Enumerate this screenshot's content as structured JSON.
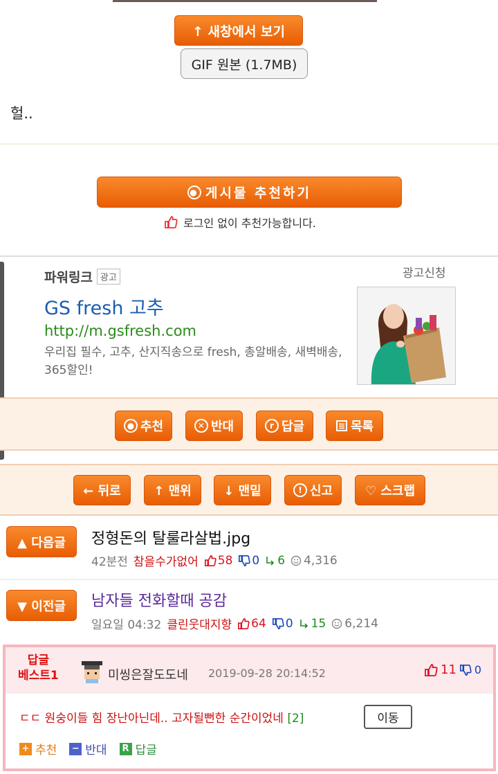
{
  "image_viewer": {
    "new_window_label": "↑ 새창에서 보기",
    "gif_original_label": "GIF 원본 (1.7MB)"
  },
  "post": {
    "body_text": "헐.."
  },
  "recommend": {
    "button_label": "게시물  추천하기",
    "login_note": "로그인 없이 추천가능합니다."
  },
  "ad": {
    "powerlink_label": "파워링크",
    "ad_tag": "광고",
    "apply_label": "광고신청",
    "headline": "GS fresh 고추",
    "url": "http://m.gsfresh.com",
    "description": "우리집 필수, 고추, 산지직송으로 fresh, 총알배송, 새벽배송, 365할인!"
  },
  "toolbar1": {
    "recommend": "추천",
    "oppose": "반대",
    "reply": "답글",
    "list": "목록"
  },
  "toolbar2": {
    "back": "← 뒤로",
    "top": "↑ 맨위",
    "bottom": "↓ 맨밑",
    "report": "신고",
    "scrap": "♡ 스크랩"
  },
  "next_post": {
    "button_label": "▲ 다음글",
    "title": "정형돈의 탈룰라살법.jpg",
    "time": "42분전",
    "author": "참을수가없어",
    "upvotes": "58",
    "downvotes": "0",
    "replies": "6",
    "views": "4,316"
  },
  "prev_post": {
    "button_label": "▼ 이전글",
    "title": "남자들 전화할때 공감",
    "time": "일요일 04:32",
    "author": "클린웃대지향",
    "upvotes": "64",
    "downvotes": "0",
    "replies": "15",
    "views": "6,214"
  },
  "best_reply": {
    "label_line1": "답글",
    "label_line2": "베스트1",
    "username": "미씽은잘도도네",
    "datetime": "2019-09-28 20:14:52",
    "upvotes": "11",
    "downvotes": "0",
    "comment": "ㄷㄷ 원숭이들 힘 장난아닌데.. 고자될뻔한 순간이었네",
    "reply_count": "[2]",
    "move_label": "이동",
    "action_recommend": "추천",
    "action_oppose": "반대",
    "action_reply": "답글"
  },
  "colors": {
    "accent_orange": "#e85d04",
    "band_bg": "#fdf1e6",
    "best_border": "#f6b6bd",
    "link_blue": "#1a5db3",
    "url_green": "#2b8a1a"
  }
}
